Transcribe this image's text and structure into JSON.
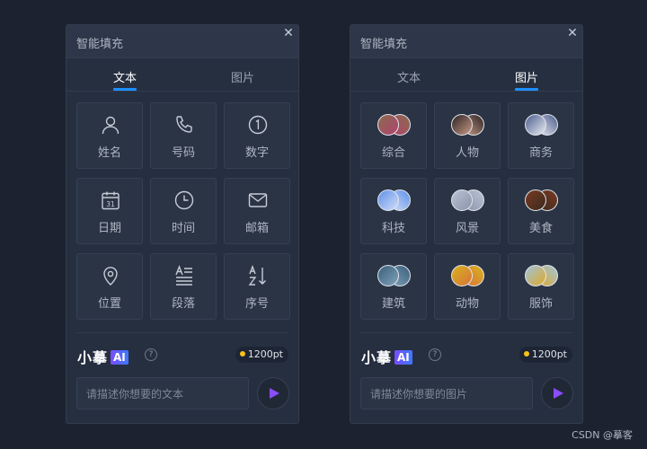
{
  "left_panel": {
    "title": "智能填充",
    "close_icon": "close-icon",
    "tabs": [
      {
        "label": "文本",
        "active": true
      },
      {
        "label": "图片",
        "active": false
      }
    ],
    "items": [
      {
        "label": "姓名",
        "icon": "person-icon"
      },
      {
        "label": "号码",
        "icon": "phone-icon"
      },
      {
        "label": "数字",
        "icon": "number-one-icon"
      },
      {
        "label": "日期",
        "icon": "calendar-icon"
      },
      {
        "label": "时间",
        "icon": "clock-icon"
      },
      {
        "label": "邮箱",
        "icon": "mail-icon"
      },
      {
        "label": "位置",
        "icon": "location-pin-icon"
      },
      {
        "label": "段落",
        "icon": "paragraph-icon"
      },
      {
        "label": "序号",
        "icon": "sort-az-icon"
      }
    ],
    "brand": {
      "name": "小摹",
      "ai": "AI"
    },
    "points": "1200pt",
    "input_placeholder": "请描述你想要的文本"
  },
  "right_panel": {
    "title": "智能填充",
    "close_icon": "close-icon",
    "tabs": [
      {
        "label": "文本",
        "active": false
      },
      {
        "label": "图片",
        "active": true
      }
    ],
    "items": [
      {
        "label": "综合",
        "colors": [
          "#8a6a4e",
          "#b0446e"
        ]
      },
      {
        "label": "人物",
        "colors": [
          "#2a2222",
          "#c99b88"
        ]
      },
      {
        "label": "商务",
        "colors": [
          "#4b5d8c",
          "#e9ecf2"
        ]
      },
      {
        "label": "科技",
        "colors": [
          "#5e8fe8",
          "#d2def8"
        ]
      },
      {
        "label": "风景",
        "colors": [
          "#b9c3d6",
          "#8a93a8"
        ]
      },
      {
        "label": "美食",
        "colors": [
          "#7a3a22",
          "#3a2a1e"
        ]
      },
      {
        "label": "建筑",
        "colors": [
          "#3b5f7c",
          "#7fa2b8"
        ]
      },
      {
        "label": "动物",
        "colors": [
          "#d9b21e",
          "#d8733a"
        ]
      },
      {
        "label": "服饰",
        "colors": [
          "#9fc4d9",
          "#e0a92a"
        ]
      }
    ],
    "brand": {
      "name": "小摹",
      "ai": "AI"
    },
    "points": "1200pt",
    "input_placeholder": "请描述你想要的图片"
  },
  "colors": {
    "accent": "#1e8fff",
    "send": "#8a4dff",
    "points_dot": "#f7c21b"
  },
  "footer": "CSDN @摹客"
}
